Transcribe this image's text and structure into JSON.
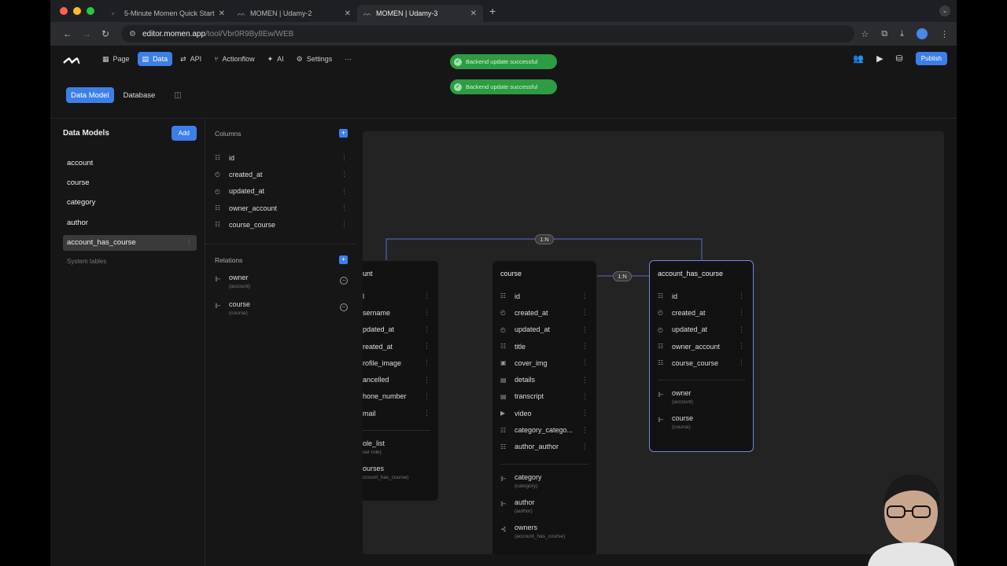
{
  "browser": {
    "tabs": [
      {
        "title": "5-Minute Momen Quick Start"
      },
      {
        "title": "MOMEN | Udamy-2"
      },
      {
        "title": "MOMEN | Udamy-3"
      }
    ],
    "url_host": "editor.momen.app",
    "url_path": "/tool/Vbr0R9By8Ew/WEB"
  },
  "header": {
    "menu": [
      {
        "label": "Page",
        "icon": "page-icon"
      },
      {
        "label": "Data",
        "icon": "data-icon"
      },
      {
        "label": "API",
        "icon": "api-icon"
      },
      {
        "label": "Actionflow",
        "icon": "actionflow-icon"
      },
      {
        "label": "AI",
        "icon": "ai-icon"
      },
      {
        "label": "Settings",
        "icon": "gear-icon"
      }
    ],
    "more": "···",
    "publish_label": "Publish"
  },
  "toasts": [
    "Backend update successful",
    "Backend update successful"
  ],
  "subtabs": {
    "data_model": "Data Model",
    "database": "Database"
  },
  "models": {
    "title": "Data Models",
    "add_label": "Add",
    "items": [
      "account",
      "course",
      "category",
      "author",
      "account_has_course"
    ],
    "selected": "account_has_course",
    "system_tables": "System tables"
  },
  "columns_panel": {
    "columns_title": "Columns",
    "columns": [
      "id",
      "created_at",
      "updated_at",
      "owner_account",
      "course_course"
    ],
    "relations_title": "Relations",
    "relations": [
      {
        "name": "owner",
        "target": "(account)"
      },
      {
        "name": "course",
        "target": "(course)"
      }
    ]
  },
  "canvas": {
    "account_card": {
      "title": "unt",
      "rows": [
        "l",
        "sername",
        "pdated_at",
        "reated_at",
        "rofile_image",
        "ancelled",
        "hone_number",
        "mail"
      ],
      "relations": [
        {
          "name": "ole_list",
          "target": "ser role)"
        },
        {
          "name": "ourses",
          "target": "ccount_has_course)"
        }
      ]
    },
    "course_card": {
      "title": "course",
      "rows": [
        "id",
        "created_at",
        "updated_at",
        "title",
        "cover_img",
        "details",
        "transcript",
        "video",
        "category_catego...",
        "author_author"
      ],
      "relations": [
        {
          "name": "category",
          "target": "(category)"
        },
        {
          "name": "author",
          "target": "(author)"
        },
        {
          "name": "owners",
          "target": "(account_has_course)"
        }
      ]
    },
    "ahc_card": {
      "title": "account_has_course",
      "rows": [
        "id",
        "created_at",
        "updated_at",
        "owner_account",
        "course_course"
      ],
      "relations": [
        {
          "name": "owner",
          "target": "(account)"
        },
        {
          "name": "course",
          "target": "(course)"
        }
      ]
    },
    "badge_top": "1:N",
    "badge_mid": "1:N"
  },
  "colors": {
    "accent": "#3d7fe8",
    "toast": "#2d9c42",
    "highlight": "#7585e8"
  }
}
